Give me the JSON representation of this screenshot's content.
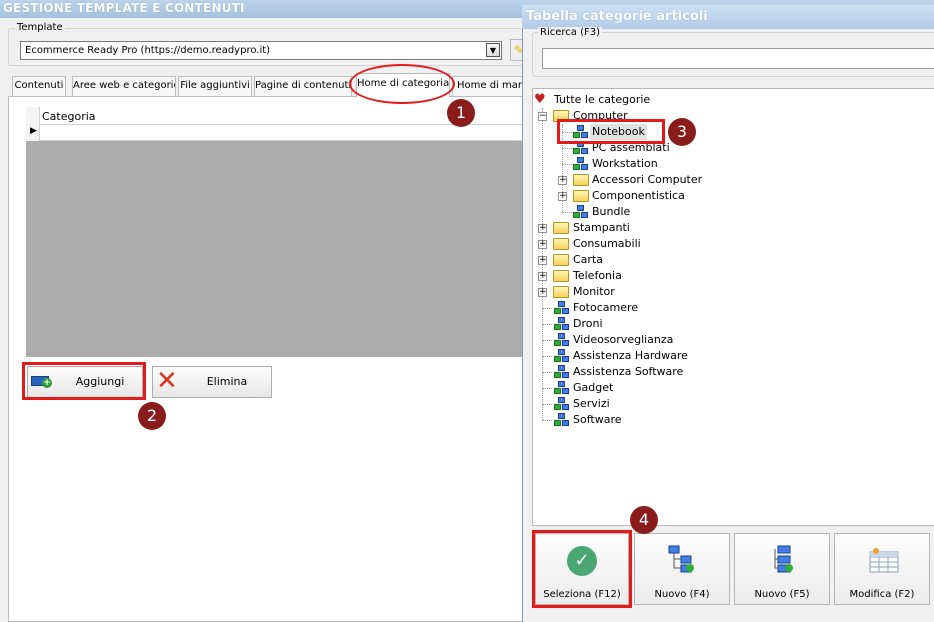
{
  "main": {
    "title": "GESTIONE TEMPLATE E CONTENUTI",
    "template_legend": "Template",
    "template_value": "Ecommerce Ready Pro (https://demo.readypro.it)",
    "tabs": [
      {
        "label": "Contenuti"
      },
      {
        "label": "Aree web e categorie"
      },
      {
        "label": "File aggiuntivi"
      },
      {
        "label": "Pagine di contenuti"
      },
      {
        "label": "Home di categoria"
      },
      {
        "label": "Home di marca"
      }
    ],
    "grid_column": "Categoria",
    "add_label": "Aggiungi",
    "delete_label": "Elimina"
  },
  "dialog": {
    "title": "Tabella categorie articoli",
    "search_legend": "Ricerca (F3)",
    "search_value": "",
    "tree": {
      "root": "Tutte le categorie",
      "computer": "Computer",
      "notebook": "Notebook",
      "pc": "PC assemblati",
      "workstation": "Workstation",
      "accessori": "Accessori Computer",
      "componentistica": "Componentistica",
      "bundle": "Bundle",
      "stampanti": "Stampanti",
      "consumabili": "Consumabili",
      "carta": "Carta",
      "telefonia": "Telefonia",
      "monitor": "Monitor",
      "fotocamere": "Fotocamere",
      "droni": "Droni",
      "video": "Videosorveglianza",
      "assistenza_hw": "Assistenza Hardware",
      "assistenza_sw": "Assistenza Software",
      "gadget": "Gadget",
      "servizi": "Servizi",
      "software": "Software"
    },
    "toolbar": {
      "select": "Seleziona (F12)",
      "new_f4": "Nuovo (F4)",
      "new_f5": "Nuovo (F5)",
      "edit_f2": "Modifica (F2)"
    }
  },
  "annotations": [
    "1",
    "2",
    "3",
    "4"
  ],
  "colors": {
    "highlight": "#e31a1a",
    "badge": "#8b1c1c"
  }
}
